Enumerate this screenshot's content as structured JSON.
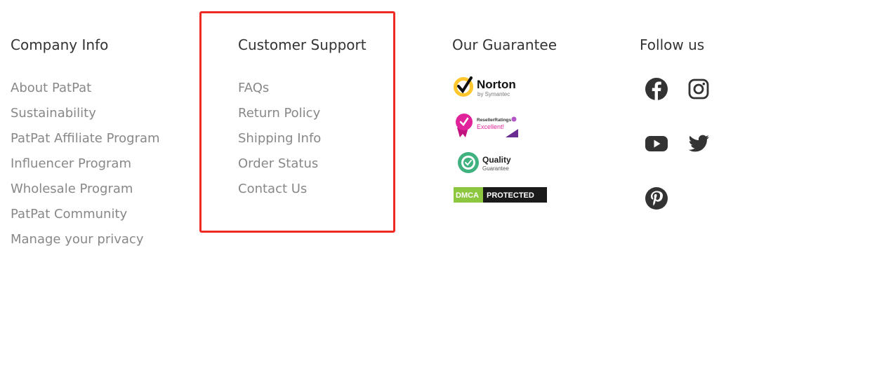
{
  "company": {
    "title": "Company Info",
    "links": [
      "About PatPat",
      "Sustainability",
      "PatPat Affiliate Program",
      "Influencer Program",
      "Wholesale Program",
      "PatPat Community",
      "Manage your privacy"
    ]
  },
  "support": {
    "title": "Customer Support",
    "links": [
      "FAQs",
      "Return Policy",
      "Shipping Info",
      "Order Status",
      "Contact Us"
    ]
  },
  "guarantee": {
    "title": "Our Guarantee",
    "badges": {
      "norton": "Norton",
      "norton_sub": "by Symantec",
      "reseller": "ResellerRatings",
      "reseller_sub": "Excellent!",
      "quality": "Quality",
      "quality_sub": "Guarantee",
      "dmca": "DMCA",
      "dmca_sub": "PROTECTED"
    }
  },
  "follow": {
    "title": "Follow us",
    "icons": [
      "facebook-icon",
      "instagram-icon",
      "youtube-icon",
      "twitter-icon",
      "pinterest-icon"
    ]
  },
  "colors": {
    "title": "#333333",
    "link": "#888888",
    "highlight": "#ee2a24",
    "icon": "#333333"
  }
}
